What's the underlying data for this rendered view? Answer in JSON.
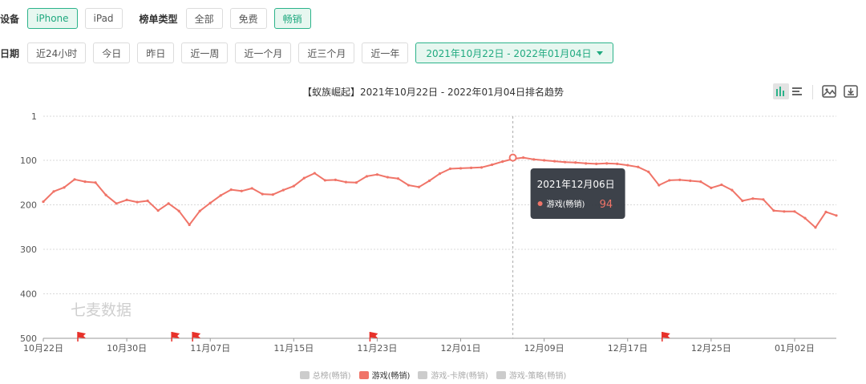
{
  "filters": {
    "device": {
      "label": "设备",
      "options": [
        {
          "label": "iPhone",
          "active": true
        },
        {
          "label": "iPad",
          "active": false
        }
      ]
    },
    "list_type": {
      "label": "榜单类型",
      "options": [
        {
          "label": "全部",
          "active": false
        },
        {
          "label": "免费",
          "active": false
        },
        {
          "label": "畅销",
          "active": true
        }
      ]
    },
    "date": {
      "label": "日期",
      "options": [
        {
          "label": "近24小时"
        },
        {
          "label": "今日"
        },
        {
          "label": "昨日"
        },
        {
          "label": "近一周"
        },
        {
          "label": "近一个月"
        },
        {
          "label": "近三个月"
        },
        {
          "label": "近一年"
        }
      ],
      "range": "2021年10月22日 - 2022年01月04日"
    }
  },
  "toolbar": {
    "icons": [
      "bar-chart-icon",
      "list-icon",
      "image-icon",
      "download-icon"
    ]
  },
  "watermark": "七麦数据",
  "colors": {
    "accent": "#2bb38a",
    "line": "#f07468",
    "grid": "#d9d9d9",
    "tooltip_bg": "#333840",
    "flag": "#e8312a"
  },
  "chart_data": {
    "type": "line",
    "title": "【蚁族崛起】2021年10月22日 - 2022年01月04日排名趋势",
    "ylim": [
      1,
      500
    ],
    "y_inverted": true,
    "y_ticks": [
      "1",
      "100",
      "200",
      "300",
      "400",
      "500"
    ],
    "x_ticks": [
      "10月22日",
      "10月30日",
      "11月07日",
      "11月15日",
      "11月23日",
      "12月01日",
      "12月09日",
      "12月17日",
      "12月25日",
      "01月02日"
    ],
    "grid": true,
    "legend_position": "bottom",
    "legend": [
      {
        "name": "总榜(畅销)",
        "active": false
      },
      {
        "name": "游戏(畅销)",
        "active": true
      },
      {
        "name": "游戏-卡牌(畅销)",
        "active": false
      },
      {
        "name": "游戏-策略(畅销)",
        "active": false
      }
    ],
    "series": [
      {
        "name": "游戏(畅销)",
        "values": [
          193,
          170,
          161,
          143,
          148,
          150,
          178,
          197,
          189,
          194,
          191,
          213,
          197,
          214,
          245,
          214,
          196,
          179,
          166,
          169,
          163,
          176,
          177,
          167,
          158,
          140,
          129,
          145,
          144,
          149,
          150,
          136,
          132,
          138,
          141,
          156,
          160,
          146,
          130,
          119,
          118,
          117,
          116,
          110,
          103,
          97,
          94,
          98,
          100,
          102,
          104,
          105,
          107,
          108,
          107,
          108,
          111,
          115,
          126,
          156,
          145,
          144,
          146,
          148,
          162,
          155,
          167,
          191,
          186,
          188,
          213,
          215,
          215,
          230,
          251,
          216,
          224
        ]
      }
    ],
    "flag_days": [
      3,
      12,
      14,
      31,
      59
    ],
    "tooltip": {
      "date": "2021年12月06日",
      "series": "游戏(畅销)",
      "value": 94,
      "day_index": 45
    }
  }
}
